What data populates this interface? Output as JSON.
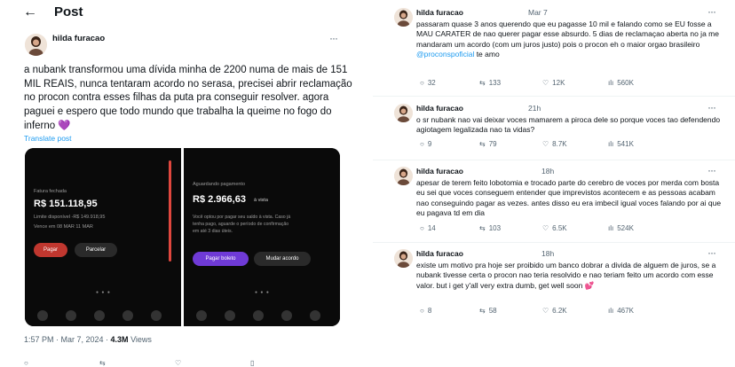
{
  "left": {
    "back_icon": "arrow-left-icon",
    "title": "Post",
    "author": "hilda furacao",
    "text": "a nubank transformou uma dívida minha de 2200 numa de mais de 151 MIL REAIS, nunca tentaram acordo no serasa, precisei abrir reclamação no procon contra esses filhas da puta pra conseguir resolver. agora paguei e espero que todo mundo que trabalha la queime no fogo do inferno 💜",
    "translate": "Translate post",
    "time": "1:57 PM · Mar 7, 2024 · ",
    "views_count": "4.3M",
    "views_label": " Views",
    "phone1": {
      "label": "Fatura fechada",
      "amount": "R$ 151.118,95",
      "limit": "Limite disponível -R$ 149.918,95",
      "due": "Vence em 08 MAR 11 MAR",
      "pay": "Pagar",
      "installments": "Parcelar"
    },
    "phone2": {
      "label": "Aguardando pagamento",
      "amount": "R$ 2.966,63",
      "amount_suffix": "à vista",
      "note_1": "Você optou por pagar seu saldo à vista. Caso já",
      "note_2": "tenha pago, aguarde o período de confirmação",
      "note_3": "em até 3 dias úteis.",
      "pay_slip": "Pagar boleto",
      "change": "Mudar acordo"
    }
  },
  "replies": [
    {
      "author": "hilda furacao",
      "time": "Mar 7",
      "text_before": "passaram quase 3 anos querendo que eu pagasse 10 mil e falando como se EU fosse a MAU CARATER de nao querer pagar esse absurdo. 5 dias de reclamaçao aberta no ja me mandaram um acordo (com um juros justo) pois o procon eh o maior orgao brasileiro ",
      "mention": "@proconspoficial",
      "text_after": " te amo",
      "replies": "32",
      "retweets": "133",
      "likes": "12K",
      "views": "560K"
    },
    {
      "author": "hilda furacao",
      "time": "21h",
      "text": "o sr nubank nao vai deixar voces mamarem a piroca dele so porque voces tao defendendo agiotagem legalizada nao ta vidas?",
      "replies": "9",
      "retweets": "79",
      "likes": "8.7K",
      "views": "541K"
    },
    {
      "author": "hilda furacao",
      "time": "18h",
      "text": "apesar de terem feito lobotomia e trocado parte do cerebro de voces por merda com bosta eu sei que voces conseguem entender que imprevistos acontecem e as pessoas acabam nao conseguindo pagar as vezes. antes disso eu era imbecil igual voces falando por ai que eu pagava td em dia",
      "replies": "14",
      "retweets": "103",
      "likes": "6.5K",
      "views": "524K"
    },
    {
      "author": "hilda furacao",
      "time": "18h",
      "text": "existe um motivo pra hoje ser proibido um banco dobrar a divida de alguem de juros, se a nubank tivesse certa o procon nao teria resolvido e nao teriam feito um acordo com esse valor. but i get y'all very extra dumb, get well soon 💕",
      "replies": "8",
      "retweets": "58",
      "likes": "6.2K",
      "views": "467K"
    }
  ],
  "icons": {
    "reply": "reply-icon",
    "retweet": "retweet-icon",
    "like": "heart-icon",
    "views": "views-icon",
    "more": "more-icon"
  },
  "colors": {
    "link": "#1d9bf0",
    "muted": "#536471",
    "accent_purple": "#6f3ad6",
    "accent_red": "#c0372f"
  }
}
